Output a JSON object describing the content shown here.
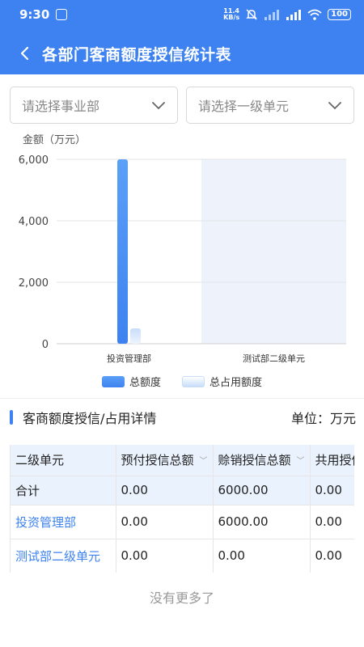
{
  "status_bar": {
    "time": "9:30",
    "net_speed_value": "11.4",
    "net_speed_unit": "KB/s",
    "battery": "100"
  },
  "nav": {
    "title": "各部门客商额度授信统计表"
  },
  "filters": {
    "division_placeholder": "请选择事业部",
    "unit_placeholder": "请选择一级单元"
  },
  "chart_data": {
    "type": "bar",
    "ylabel": "金额（万元）",
    "categories": [
      "投资管理部",
      "测试部二级单元"
    ],
    "series": [
      {
        "name": "总额度",
        "values": [
          6000,
          0
        ]
      },
      {
        "name": "总占用额度",
        "values": [
          500,
          0
        ]
      }
    ],
    "ylim": [
      0,
      6000
    ],
    "yticks": [
      "0",
      "2,000",
      "4,000",
      "6,000"
    ],
    "ytick_values": [
      0,
      2000,
      4000,
      6000
    ],
    "highlight_category_index": 1,
    "legend_position": "bottom",
    "colors": {
      "total": "#3d82f0",
      "used": "#c8ddfa",
      "highlight": "#eef3fb"
    }
  },
  "section": {
    "title": "客商额度授信/占用详情",
    "unit": "单位：万元"
  },
  "table": {
    "headers": [
      "二级单元",
      "预付授信总额",
      "赊销授信总额",
      "共用授信"
    ],
    "rows": [
      {
        "cells": [
          "合计",
          "0.00",
          "6000.00",
          "0.00"
        ]
      },
      {
        "cells": [
          "投资管理部",
          "0.00",
          "6000.00",
          "0.00"
        ]
      },
      {
        "cells": [
          "测试部二级单元",
          "0.00",
          "0.00",
          "0.00"
        ]
      }
    ]
  },
  "footer": {
    "no_more": "没有更多了"
  },
  "colors": {
    "brand": "#3d82f0",
    "header_bg": "#3d82f0",
    "table_header_bg": "#eaf2fd"
  }
}
